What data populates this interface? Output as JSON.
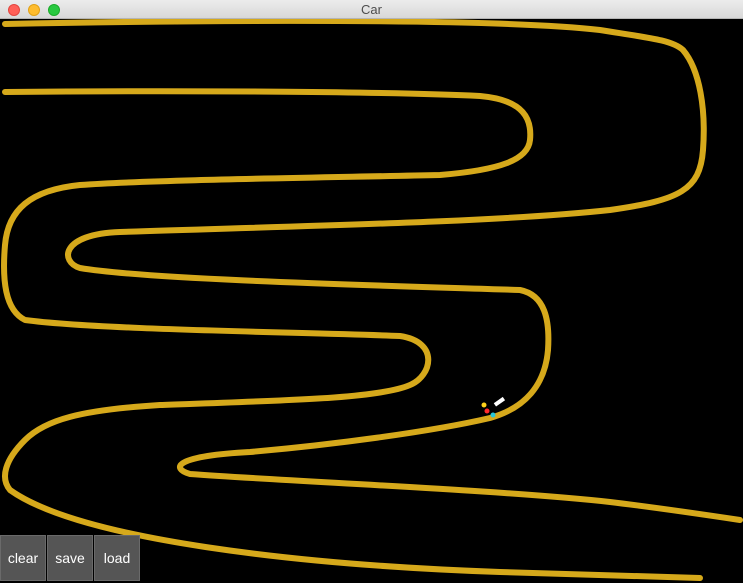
{
  "window": {
    "title": "Car"
  },
  "colors": {
    "track": "#d6a91b",
    "background": "#000000",
    "car_body": "#ffffff",
    "sensor_yellow": "#ffd21a",
    "sensor_red": "#ff2a2a",
    "sensor_cyan": "#29c6d6"
  },
  "buttons": {
    "clear": "clear",
    "save": "save",
    "load": "load"
  }
}
